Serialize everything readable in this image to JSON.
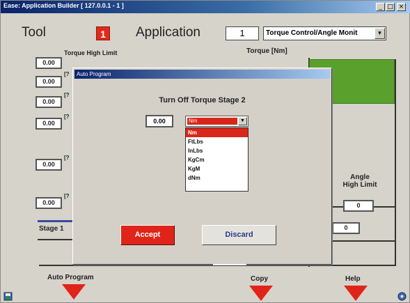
{
  "window": {
    "title": "Ease: Application Builder  [ 127.0.0.1 - 1 ]",
    "minimize": "_",
    "maximize": "□",
    "close": "×"
  },
  "header": {
    "tool_label": "Tool",
    "tool_number": "1",
    "application_label": "Application",
    "application_number": "1",
    "strategy_select": "Torque Control/Angle Monit"
  },
  "chart": {
    "torque_axis_label": "Torque [Nm]",
    "torque_high_limit_label": "Torque High Limit",
    "row_values": [
      "0.00",
      "0.00",
      "0.00",
      "0.00",
      "0.00",
      "0.00"
    ],
    "row_units": [
      "[?",
      "[?",
      "[?",
      "[?",
      "[?"
    ],
    "angle_high_limit_label": "Angle\nHigh Limit",
    "angle_high_limit_value": "0",
    "angle_value_2": "0",
    "stage_label": "Stage 1"
  },
  "dialog": {
    "title": "Auto Program",
    "heading": "Turn Off Torque Stage 2",
    "value": "0.00",
    "unit_selected": "Nm",
    "unit_options": [
      "Nm",
      "FtLbs",
      "InLbs",
      "KgCm",
      "KgM",
      "dNm"
    ],
    "highlighted_index": 0,
    "accept_label": "Accept",
    "discard_label": "Discard"
  },
  "bottom": {
    "auto_program_label": "Auto Program",
    "copy_label": "Copy",
    "help_label": "Help"
  },
  "colors": {
    "accent_red": "#e0241a",
    "green_zone": "#5aa02c",
    "titlebar": "#0a246a"
  }
}
